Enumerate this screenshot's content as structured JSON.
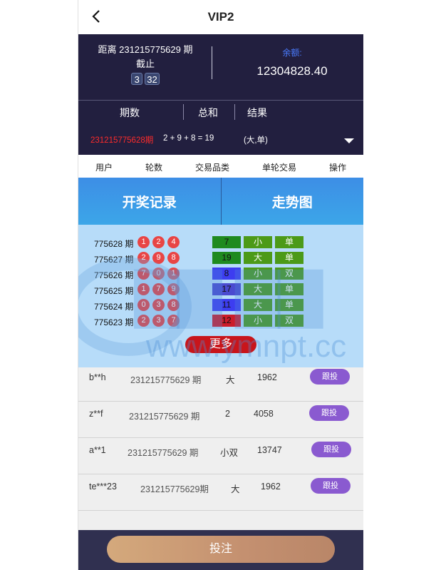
{
  "nav": {
    "title": "VIP2",
    "back_icon": "chevron-left-icon"
  },
  "info": {
    "countdown_line1": "距离 231215775629 期",
    "countdown_line2": "截止",
    "timer": [
      "3",
      "32"
    ],
    "balance_label": "余额:",
    "balance_value": "12304828.40"
  },
  "result_header": {
    "period": "期数",
    "sum": "总和",
    "result": "结果"
  },
  "latest": {
    "period": "231215775628期",
    "formula": "2 + 9 + 8 = 19",
    "result": "(大,单)",
    "toggle_icon": "caret-down-icon"
  },
  "columns": [
    "用户",
    "轮数",
    "交易品类",
    "单轮交易",
    "操作"
  ],
  "tabs": [
    "开奖记录",
    "走势图"
  ],
  "history": [
    {
      "period": "775628 期",
      "balls": [
        "1",
        "2",
        "4"
      ],
      "sum": "7",
      "sum_color": "#1f8a1f",
      "size": "小",
      "parity": "单"
    },
    {
      "period": "775627 期",
      "balls": [
        "2",
        "9",
        "8"
      ],
      "sum": "19",
      "sum_color": "#1f8a1f",
      "size": "大",
      "parity": "单"
    },
    {
      "period": "775626 期",
      "balls": [
        "7",
        "0",
        "1"
      ],
      "sum": "8",
      "sum_color": "#3d3df0",
      "size": "小",
      "parity": "双"
    },
    {
      "period": "775625 期",
      "balls": [
        "1",
        "7",
        "9"
      ],
      "sum": "17",
      "sum_color": "#4a4ad0",
      "size": "大",
      "parity": "单"
    },
    {
      "period": "775624 期",
      "balls": [
        "0",
        "3",
        "8"
      ],
      "sum": "11",
      "sum_color": "#3d3df0",
      "size": "大",
      "parity": "单"
    },
    {
      "period": "775623 期",
      "balls": [
        "2",
        "3",
        "7"
      ],
      "sum": "12",
      "sum_color": "#cc1c2a",
      "size": "小",
      "parity": "双"
    }
  ],
  "more_label": "更多",
  "watermark": "www.ymnpt.cc",
  "bets": [
    {
      "user": "b**h",
      "period": "231215775629 期",
      "type": "大",
      "amount": "1962",
      "action": "跟投"
    },
    {
      "user": "z**f",
      "period": "231215775629 期",
      "type": "2",
      "amount": "4058",
      "action": "跟投"
    },
    {
      "user": "a**1",
      "period": "231215775629 期",
      "type": "小双",
      "amount": "13747",
      "action": "跟投"
    },
    {
      "user": "te***23",
      "period": "231215775629期",
      "type": "大",
      "amount": "1962",
      "action": "跟投"
    }
  ],
  "bottom": {
    "bet_button": "投注"
  }
}
